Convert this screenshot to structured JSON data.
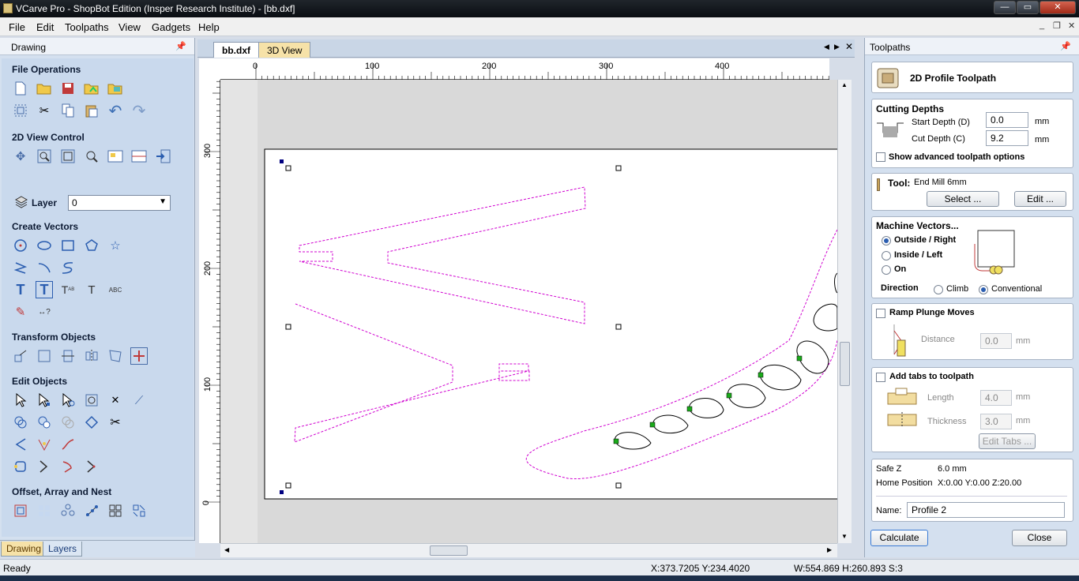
{
  "titlebar": {
    "title": "VCarve Pro - ShopBot Edition (Insper Research Institute) - [bb.dxf]",
    "minimize": "—",
    "maximize": "▭",
    "close": "✕"
  },
  "menu": {
    "items": [
      "File",
      "Edit",
      "Toolpaths",
      "View",
      "Gadgets",
      "Help"
    ],
    "mdi_minimize": "_",
    "mdi_restore": "❐",
    "mdi_close": "✕"
  },
  "left_panel": {
    "title": "Drawing",
    "pin": "📌",
    "sections": {
      "file_operations": "File Operations",
      "view_control": "2D View Control",
      "layer_label": "Layer",
      "layer_value": "0",
      "create_vectors": "Create Vectors",
      "transform_objects": "Transform Objects",
      "edit_objects": "Edit Objects",
      "offset_array_nest": "Offset, Array and Nest"
    },
    "tabs": [
      "Drawing",
      "Layers"
    ]
  },
  "document": {
    "tabs": [
      "bb.dxf",
      "3D View"
    ],
    "h_ruler_labels": [
      "0",
      "100",
      "200",
      "300",
      "400"
    ],
    "v_ruler_labels": [
      "300",
      "200",
      "100",
      "0"
    ]
  },
  "right_panel": {
    "title": "Toolpaths",
    "toolpath_title": "2D Profile Toolpath",
    "cutting_depths": {
      "header": "Cutting Depths",
      "start_label": "Start Depth (D)",
      "start_value": "0.0",
      "cut_label": "Cut Depth (C)",
      "cut_value": "9.2",
      "unit": "mm",
      "advanced": "Show advanced toolpath options"
    },
    "tool": {
      "label": "Tool:",
      "name": "End Mill 6mm",
      "select": "Select ...",
      "edit": "Edit ..."
    },
    "machine_vectors": {
      "header": "Machine Vectors...",
      "outside": "Outside / Right",
      "inside": "Inside / Left",
      "on": "On",
      "direction": "Direction",
      "climb": "Climb",
      "conventional": "Conventional"
    },
    "ramp": {
      "header": "Ramp Plunge Moves",
      "distance_label": "Distance",
      "distance_value": "0.0",
      "unit": "mm"
    },
    "tabs": {
      "header": "Add tabs to toolpath",
      "length_label": "Length",
      "length_value": "4.0",
      "thickness_label": "Thickness",
      "thickness_value": "3.0",
      "unit": "mm",
      "edit_tabs": "Edit Tabs ..."
    },
    "safe_z_label": "Safe Z",
    "safe_z_value": "6.0 mm",
    "home_label": "Home Position",
    "home_value": "X:0.00 Y:0.00 Z:20.00",
    "name_label": "Name:",
    "name_value": "Profile 2",
    "calculate": "Calculate",
    "close": "Close"
  },
  "status": {
    "ready": "Ready",
    "coords": "X:373.7205 Y:234.4020",
    "dims": "W:554.869  H:260.893  S:3"
  }
}
